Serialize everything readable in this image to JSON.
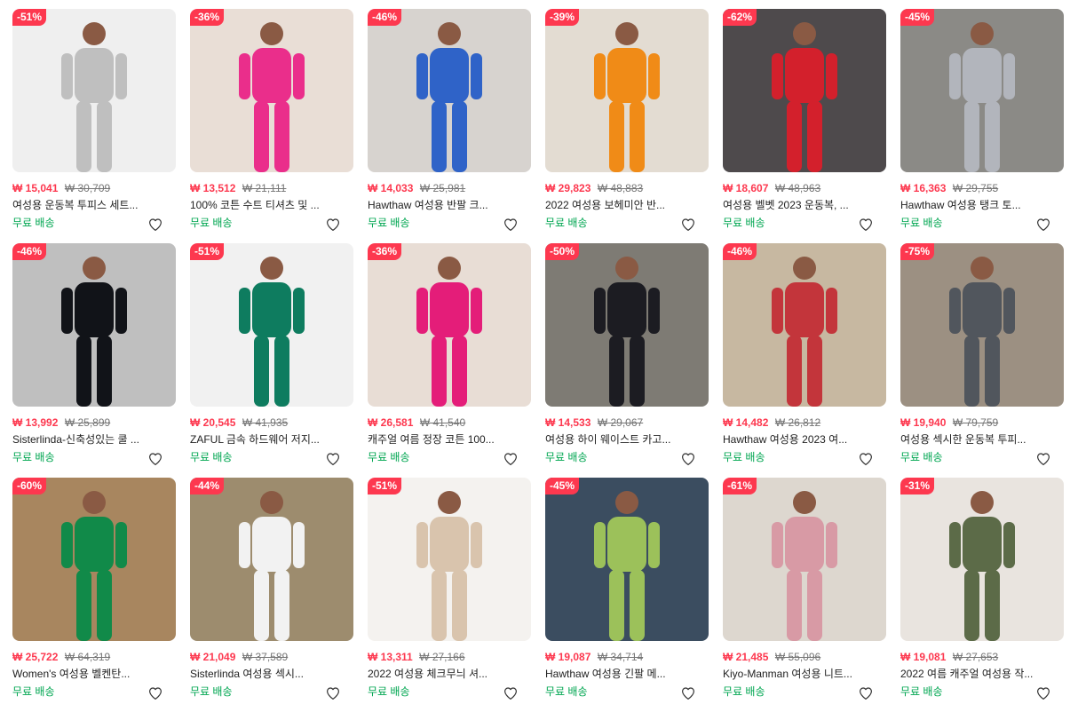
{
  "products": [
    {
      "discount": "-51%",
      "price": "₩ 15,041",
      "original": "₩ 30,709",
      "title": "여성용 운동복 투피스 세트...",
      "shipping": "무료 배송",
      "colors": {
        "bg": "#efefef",
        "fig": "#bfbfbf"
      }
    },
    {
      "discount": "-36%",
      "price": "₩ 13,512",
      "original": "₩ 21,111",
      "title": "100% 코튼 수트 티셔츠 및 ...",
      "shipping": "무료 배송",
      "colors": {
        "bg": "#e9ded6",
        "fig": "#ea2e8b"
      }
    },
    {
      "discount": "-46%",
      "price": "₩ 14,033",
      "original": "₩ 25,981",
      "title": "Hawthaw 여성용 반팔 크...",
      "shipping": "무료 배송",
      "colors": {
        "bg": "#d7d3cf",
        "fig": "#2f63c8"
      }
    },
    {
      "discount": "-39%",
      "price": "₩ 29,823",
      "original": "₩ 48,883",
      "title": "2022 여성용 보헤미안 반...",
      "shipping": "무료 배송",
      "colors": {
        "bg": "#e3dcd2",
        "fig": "#f08b17"
      }
    },
    {
      "discount": "-62%",
      "price": "₩ 18,607",
      "original": "₩ 48,963",
      "title": "여성용 벨벳 2023 운동복, ...",
      "shipping": "무료 배송",
      "colors": {
        "bg": "#4e4a4c",
        "fig": "#d3202c"
      }
    },
    {
      "discount": "-45%",
      "price": "₩ 16,363",
      "original": "₩ 29,755",
      "title": "Hawthaw 여성용 탱크 토...",
      "shipping": "무료 배송",
      "colors": {
        "bg": "#8b8a86",
        "fig": "#b2b5bc"
      }
    },
    {
      "discount": "-46%",
      "price": "₩ 13,992",
      "original": "₩ 25,899",
      "title": "Sisterlinda-신축성있는 쿨 ...",
      "shipping": "무료 배송",
      "colors": {
        "bg": "#bfbfbf",
        "fig": "#111318"
      }
    },
    {
      "discount": "-51%",
      "price": "₩ 20,545",
      "original": "₩ 41,935",
      "title": "ZAFUL 금속 하드웨어 저지...",
      "shipping": "무료 배송",
      "colors": {
        "bg": "#f1f1f1",
        "fig": "#0e7c5f"
      }
    },
    {
      "discount": "-36%",
      "price": "₩ 26,581",
      "original": "₩ 41,540",
      "title": "캐주얼 여름 정장 코튼 100...",
      "shipping": "무료 배송",
      "colors": {
        "bg": "#e8ddd5",
        "fig": "#e41d79"
      }
    },
    {
      "discount": "-50%",
      "price": "₩ 14,533",
      "original": "₩ 29,067",
      "title": "여성용 하이 웨이스트 카고...",
      "shipping": "무료 배송",
      "colors": {
        "bg": "#7e7b74",
        "fig": "#1c1c22"
      }
    },
    {
      "discount": "-46%",
      "price": "₩ 14,482",
      "original": "₩ 26,812",
      "title": "Hawthaw 여성용 2023 여...",
      "shipping": "무료 배송",
      "colors": {
        "bg": "#c7b8a1",
        "fig": "#c3353b"
      }
    },
    {
      "discount": "-75%",
      "price": "₩ 19,940",
      "original": "₩ 79,759",
      "title": "여성용 섹시한 운동복 투피...",
      "shipping": "무료 배송",
      "colors": {
        "bg": "#9c9082",
        "fig": "#51565d"
      }
    },
    {
      "discount": "-60%",
      "price": "₩ 25,722",
      "original": "₩ 64,319",
      "title": "Women's 여성용 벨켄탄...",
      "shipping": "무료 배송",
      "colors": {
        "bg": "#a8865f",
        "fig": "#118a49"
      }
    },
    {
      "discount": "-44%",
      "price": "₩ 21,049",
      "original": "₩ 37,589",
      "title": "Sisterlinda 여성용 섹시...",
      "shipping": "무료 배송",
      "colors": {
        "bg": "#9d8c6e",
        "fig": "#f2f2f2"
      }
    },
    {
      "discount": "-51%",
      "price": "₩ 13,311",
      "original": "₩ 27,166",
      "title": "2022 여성용 체크무늬 셔...",
      "shipping": "무료 배송",
      "colors": {
        "bg": "#f4f2ef",
        "fig": "#d9c4ad"
      }
    },
    {
      "discount": "-45%",
      "price": "₩ 19,087",
      "original": "₩ 34,714",
      "title": "Hawthaw 여성용 긴팔 메...",
      "shipping": "무료 배송",
      "colors": {
        "bg": "#3b4d60",
        "fig": "#9cc15a"
      }
    },
    {
      "discount": "-61%",
      "price": "₩ 21,485",
      "original": "₩ 55,096",
      "title": "Kiyo-Manman 여성용 니트...",
      "shipping": "무료 배송",
      "colors": {
        "bg": "#ddd7cf",
        "fig": "#d89aa5"
      }
    },
    {
      "discount": "-31%",
      "price": "₩ 19,081",
      "original": "₩ 27,653",
      "title": "2022 여름 캐주얼 여성용 작...",
      "shipping": "무료 배송",
      "colors": {
        "bg": "#e9e4df",
        "fig": "#5c6b48"
      }
    }
  ],
  "icons": {
    "wishlist": "heart-outline-icon"
  }
}
